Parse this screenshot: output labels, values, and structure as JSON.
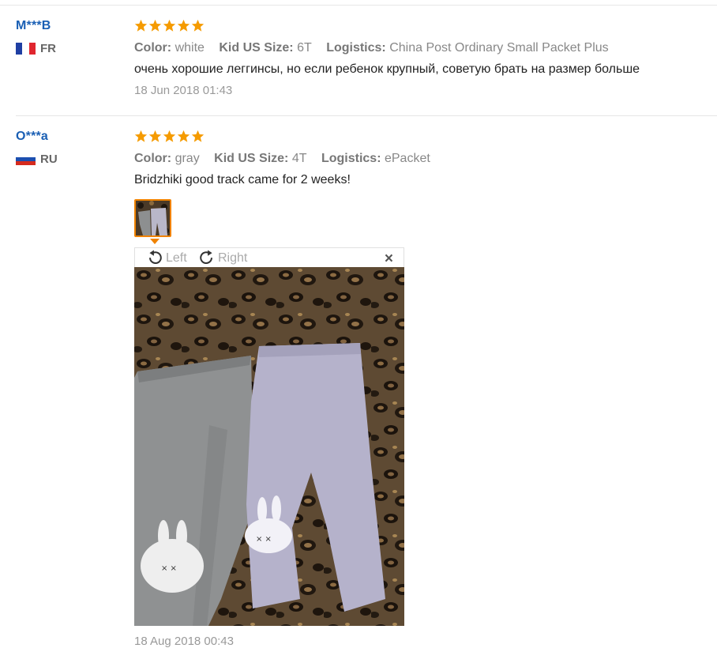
{
  "reviews": [
    {
      "user": "M***B",
      "country": "FR",
      "stars": 5,
      "attrs": [
        {
          "key": "Color:",
          "value": "white"
        },
        {
          "key": "Kid US Size:",
          "value": "6T"
        },
        {
          "key": "Logistics:",
          "value": "China Post Ordinary Small Packet Plus"
        }
      ],
      "text": "очень хорошие леггинсы, но если ребенок крупный, советую брать на размер больше",
      "date": "18 Jun 2018 01:43"
    },
    {
      "user": "O***a",
      "country": "RU",
      "stars": 5,
      "attrs": [
        {
          "key": "Color:",
          "value": "gray"
        },
        {
          "key": "Kid US Size:",
          "value": "4T"
        },
        {
          "key": "Logistics:",
          "value": "ePacket"
        }
      ],
      "text": "Bridzhiki good track came for 2 weeks!",
      "date": "18 Aug 2018 00:43"
    }
  ],
  "viewer": {
    "rotate_left": "Left",
    "rotate_right": "Right",
    "close_glyph": "×"
  },
  "icons": {
    "star": "star-icon",
    "rotate_left": "rotate-left-icon",
    "rotate_right": "rotate-right-icon",
    "close": "close-icon"
  },
  "colors": {
    "star": "#f59b00",
    "username": "#1a5fb4",
    "thumb_border": "#f08200"
  }
}
